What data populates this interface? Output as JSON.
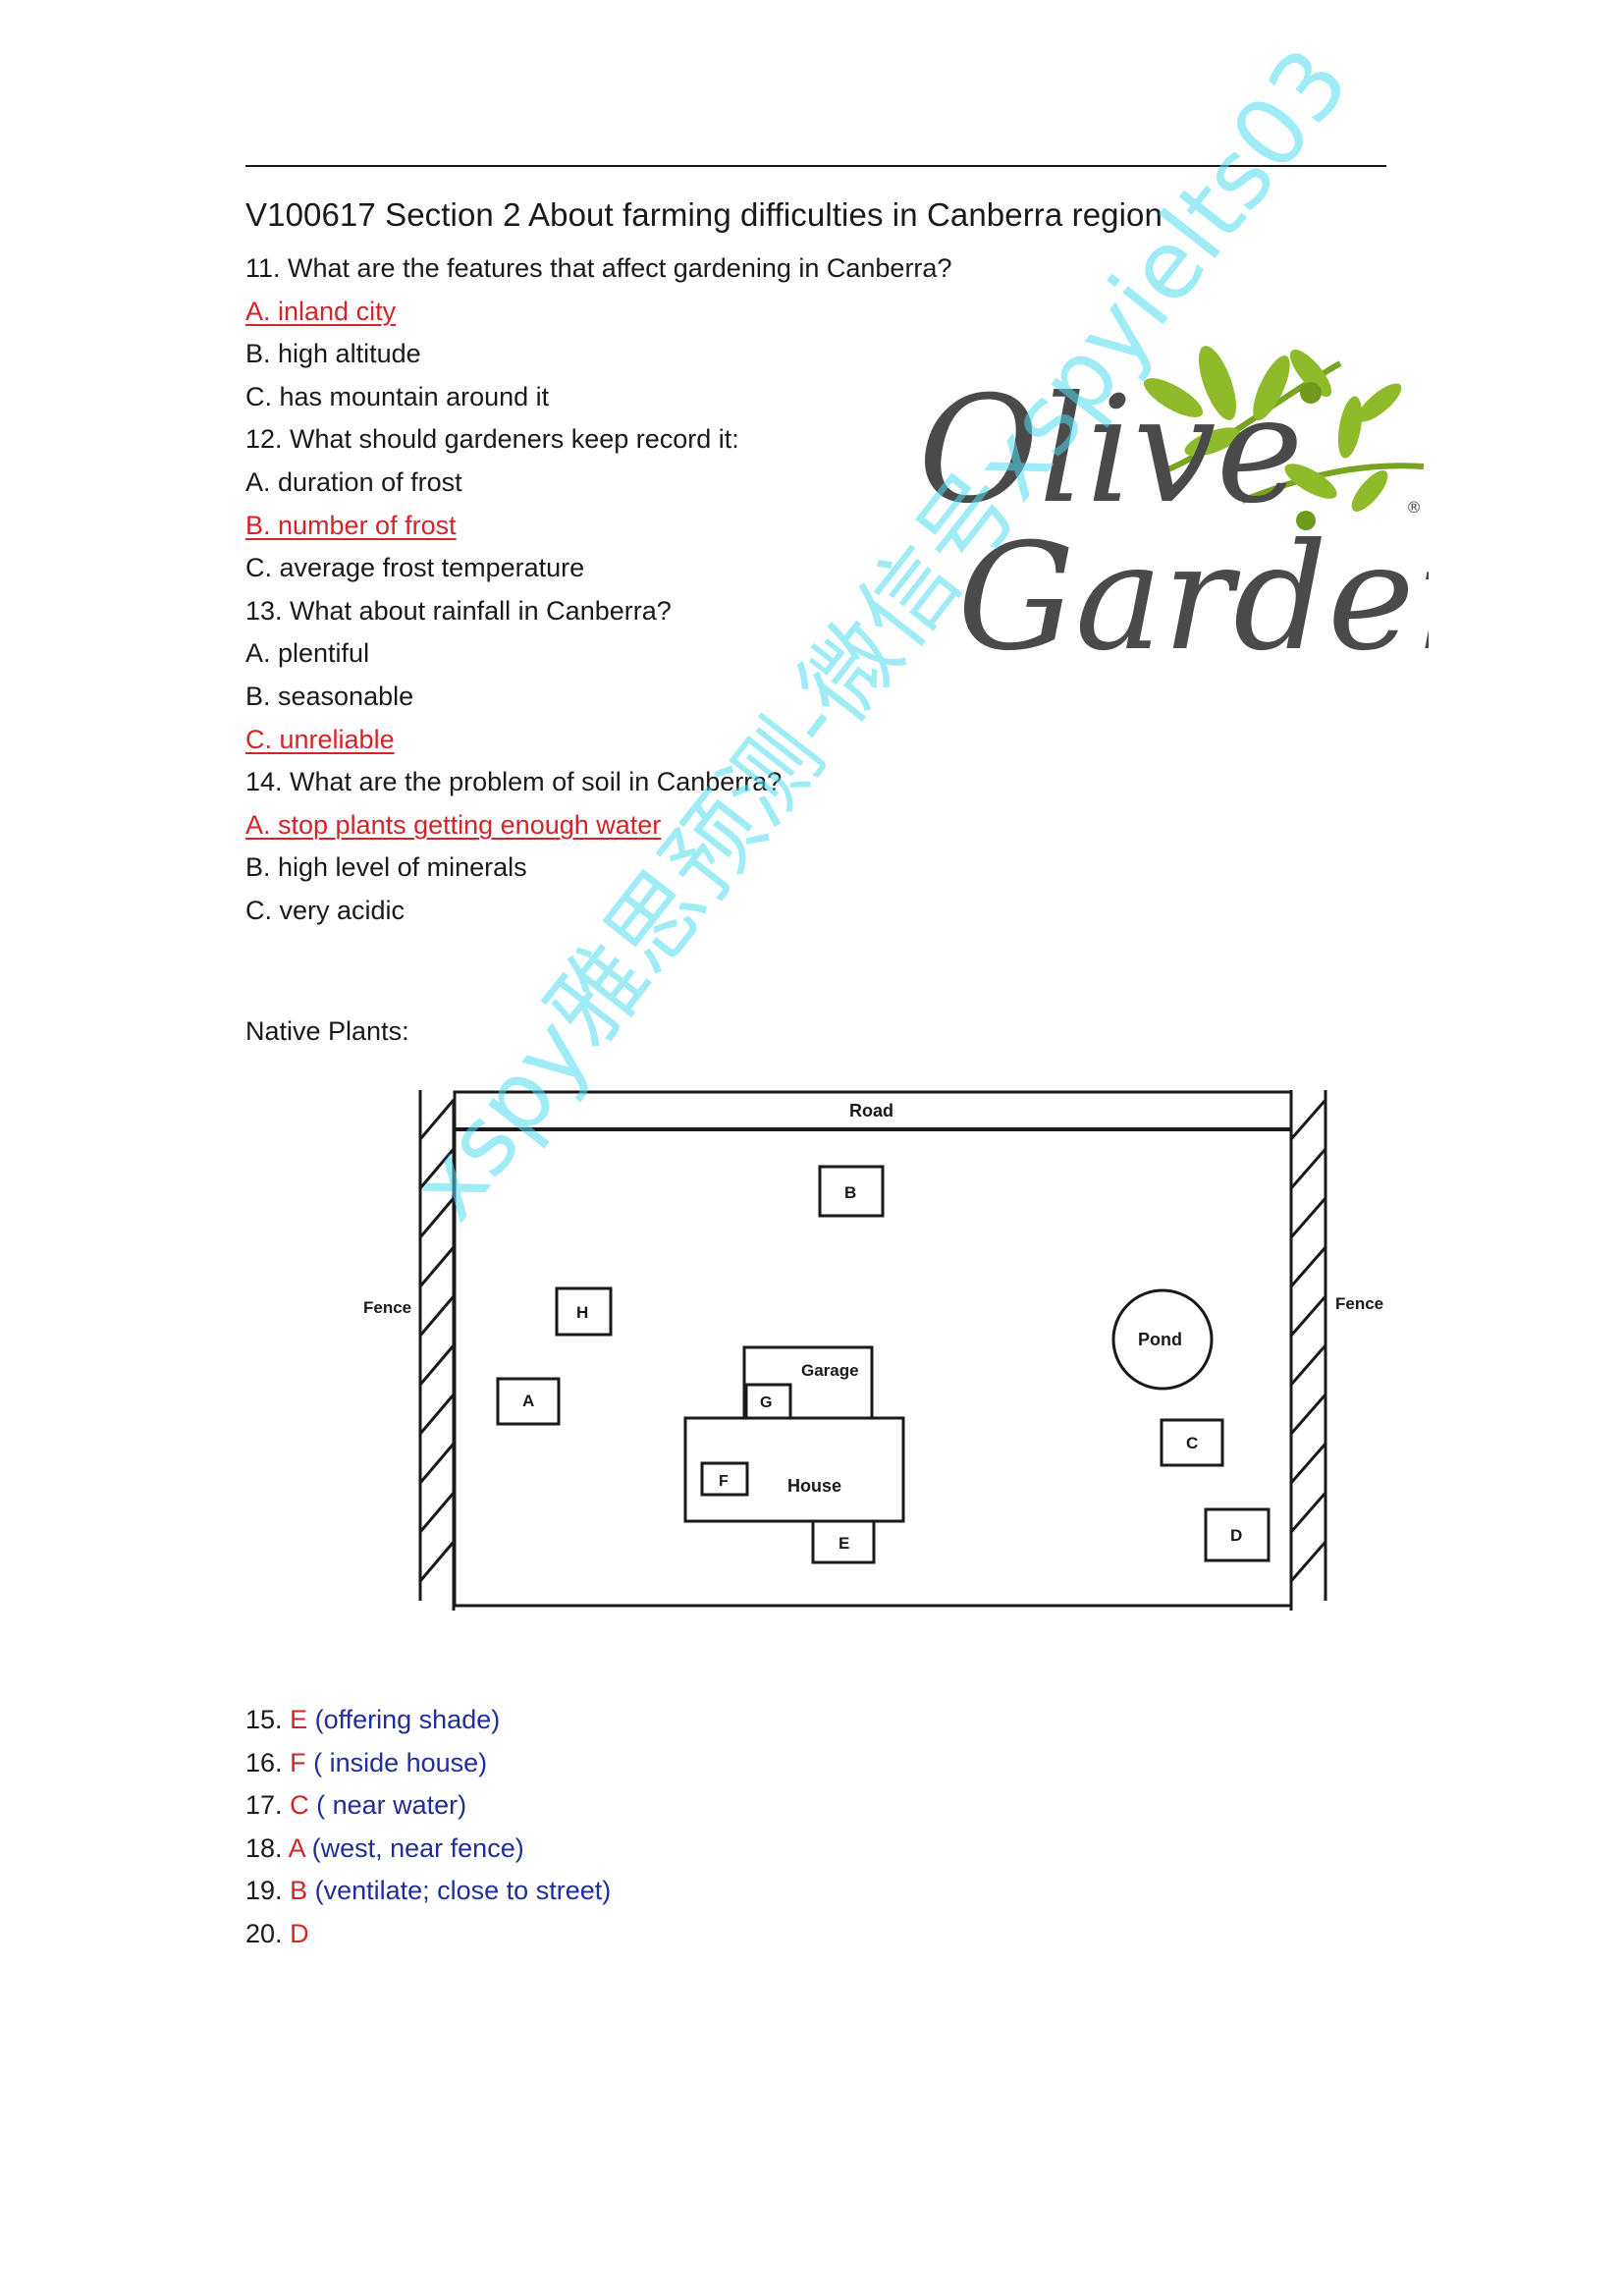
{
  "title": "V100617 Section 2 About farming difficulties in Canberra region",
  "questions": [
    {
      "text": "11. What are the features that affect gardening in Canberra?",
      "answer": false
    },
    {
      "text": "A. inland city",
      "answer": true
    },
    {
      "text": "B. high altitude",
      "answer": false
    },
    {
      "text": "C. has mountain around it",
      "answer": false
    },
    {
      "text": "12. What should gardeners keep record it:",
      "answer": false
    },
    {
      "text": "A. duration of frost",
      "answer": false
    },
    {
      "text": "B. number of frost",
      "answer": true
    },
    {
      "text": "C. average frost temperature",
      "answer": false
    },
    {
      "text": "13. What about rainfall in Canberra?",
      "answer": false
    },
    {
      "text": "A. plentiful",
      "answer": false
    },
    {
      "text": "B. seasonable",
      "answer": false
    },
    {
      "text": "C. unreliable",
      "answer": true
    },
    {
      "text": "14. What are the problem of soil in Canberra?",
      "answer": false
    },
    {
      "text": "A. stop plants getting enough water",
      "answer": true
    },
    {
      "text": "B. high level of minerals",
      "answer": false
    },
    {
      "text": "C. very acidic",
      "answer": false
    }
  ],
  "logo": {
    "line1": "Olive",
    "line2": "Garden",
    "mark": "®"
  },
  "native_plants_label": "Native Plants:",
  "map": {
    "road": "Road",
    "fence_left": "Fence",
    "fence_right": "Fence",
    "pond": "Pond",
    "garage": "Garage",
    "house": "House",
    "boxes": {
      "A": "A",
      "B": "B",
      "C": "C",
      "D": "D",
      "E": "E",
      "F": "F",
      "G": "G",
      "H": "H"
    }
  },
  "answers": [
    {
      "num": "15.",
      "letter": "E",
      "note": "(offering shade)"
    },
    {
      "num": "16.",
      "letter": "F",
      "note": "( inside house)"
    },
    {
      "num": "17.",
      "letter": "C",
      "note": "( near water)"
    },
    {
      "num": "18.",
      "letter": "A",
      "note": "(west, near fence)"
    },
    {
      "num": "19.",
      "letter": "B",
      "note": "(ventilate; close to street)"
    },
    {
      "num": "20.",
      "letter": "D",
      "note": ""
    }
  ],
  "watermark": "xspy雅思预测-微信号xspyielts03",
  "colors": {
    "answer_red": "#d3242a",
    "note_blue": "#1f2f9a",
    "logo_green": "#8fba2a",
    "logo_gray": "#4a4a4a"
  }
}
